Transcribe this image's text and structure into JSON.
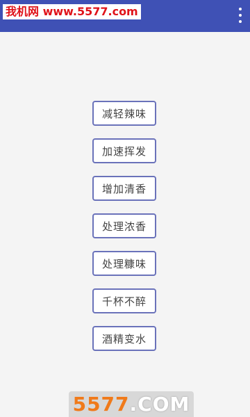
{
  "header": {
    "watermark_text": "我机网 www.5577.com",
    "menu_icon": "overflow-menu-icon"
  },
  "actions": [
    {
      "label": "减轻辣味"
    },
    {
      "label": "加速挥发"
    },
    {
      "label": "增加清香"
    },
    {
      "label": "处理浓香"
    },
    {
      "label": "处理糠味"
    },
    {
      "label": "千杯不醉"
    },
    {
      "label": "酒精变水"
    }
  ],
  "footer": {
    "watermark_num": "5577",
    "watermark_dom": ".COM"
  },
  "colors": {
    "app_bar": "#3f51b5",
    "button_border": "#6a72ba",
    "background": "#f4f4f4",
    "watermark_red": "#e0131a",
    "watermark_orange": "#f07a1a"
  }
}
